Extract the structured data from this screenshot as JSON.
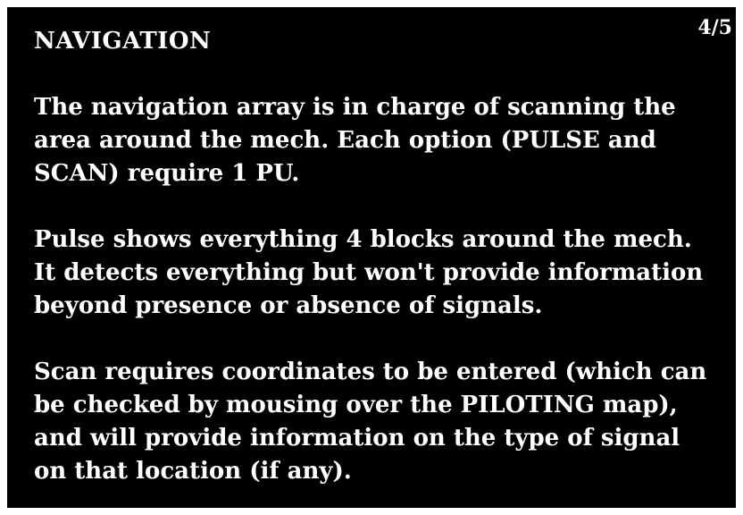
{
  "panel": {
    "title": "NAVIGATION",
    "page_indicator": "4/5",
    "background_color": "#000000",
    "text_color": "#ffffff",
    "paragraphs": [
      {
        "lines": [
          "The navigation array is in charge of scanning the",
          "area around the mech. Each option (PULSE and",
          "SCAN) require 1 PU."
        ]
      },
      {
        "lines": [
          "Pulse shows everything 4 blocks around the mech.",
          "It detects everything but won't provide information",
          "beyond presence or absence of signals."
        ]
      },
      {
        "lines": [
          "Scan requires coordinates to be entered (which can",
          "be checked by mousing over the PILOTING map),",
          "and will provide information on the type of signal",
          "on that location (if any)."
        ]
      }
    ]
  }
}
